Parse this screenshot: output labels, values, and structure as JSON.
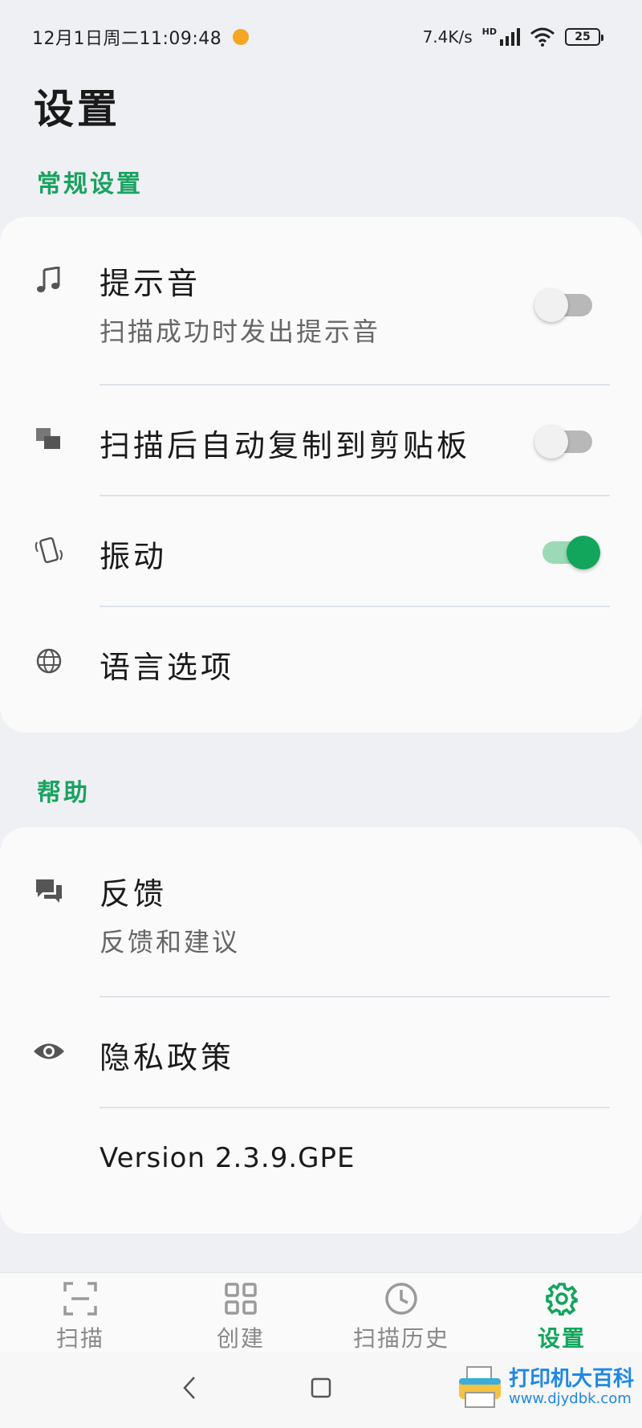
{
  "status_bar": {
    "time": "12月1日周二11:09:48",
    "speed": "7.4K/s",
    "network_badge": "HD",
    "battery": "25"
  },
  "page_title": "设置",
  "general_section": {
    "label": "常规设置",
    "items": [
      {
        "title": "提示音",
        "subtitle": "扫描成功时发出提示音",
        "icon": "music-note-icon",
        "toggle": false
      },
      {
        "title": "扫描后自动复制到剪贴板",
        "icon": "copy-icon",
        "toggle": false
      },
      {
        "title": "振动",
        "icon": "vibration-icon",
        "toggle": true
      },
      {
        "title": "语言选项",
        "icon": "globe-icon"
      }
    ]
  },
  "help_section": {
    "label": "帮助",
    "items": [
      {
        "title": "反馈",
        "subtitle": "反馈和建议",
        "icon": "feedback-icon"
      },
      {
        "title": "隐私政策",
        "icon": "eye-icon"
      }
    ],
    "version": "Version 2.3.9.GPE"
  },
  "bottom_nav": {
    "items": [
      {
        "label": "扫描",
        "icon": "scan-icon",
        "active": false
      },
      {
        "label": "创建",
        "icon": "grid-icon",
        "active": false
      },
      {
        "label": "扫描历史",
        "icon": "clock-icon",
        "active": false
      },
      {
        "label": "设置",
        "icon": "gear-icon",
        "active": true
      }
    ]
  },
  "watermark": {
    "text": "打印机大百科",
    "url": "www.djydbk.com"
  },
  "colors": {
    "accent": "#12a55c",
    "background": "#eef0f4",
    "card": "#fafafa"
  }
}
